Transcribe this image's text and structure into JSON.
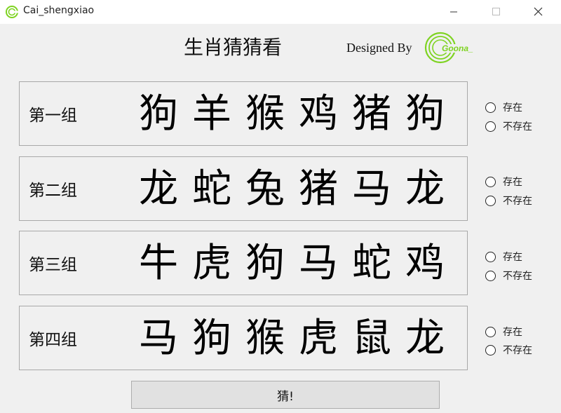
{
  "window": {
    "title": "Cai_shengxiao",
    "minimize_icon": "minimize-icon",
    "maximize_icon": "maximize-icon",
    "close_icon": "close-icon"
  },
  "header": {
    "title": "生肖猜猜看",
    "designed_by": "Designed By",
    "logo_text": "Goona_",
    "logo_color": "#7ed321"
  },
  "groups": [
    {
      "label": "第一组",
      "animals": [
        "狗",
        "羊",
        "猴",
        "鸡",
        "猪",
        "狗"
      ]
    },
    {
      "label": "第二组",
      "animals": [
        "龙",
        "蛇",
        "兔",
        "猪",
        "马",
        "龙"
      ]
    },
    {
      "label": "第三组",
      "animals": [
        "牛",
        "虎",
        "狗",
        "马",
        "蛇",
        "鸡"
      ]
    },
    {
      "label": "第四组",
      "animals": [
        "马",
        "狗",
        "猴",
        "虎",
        "鼠",
        "龙"
      ]
    }
  ],
  "options": {
    "exists": "存在",
    "not_exists": "不存在"
  },
  "guess_button": "猜!"
}
